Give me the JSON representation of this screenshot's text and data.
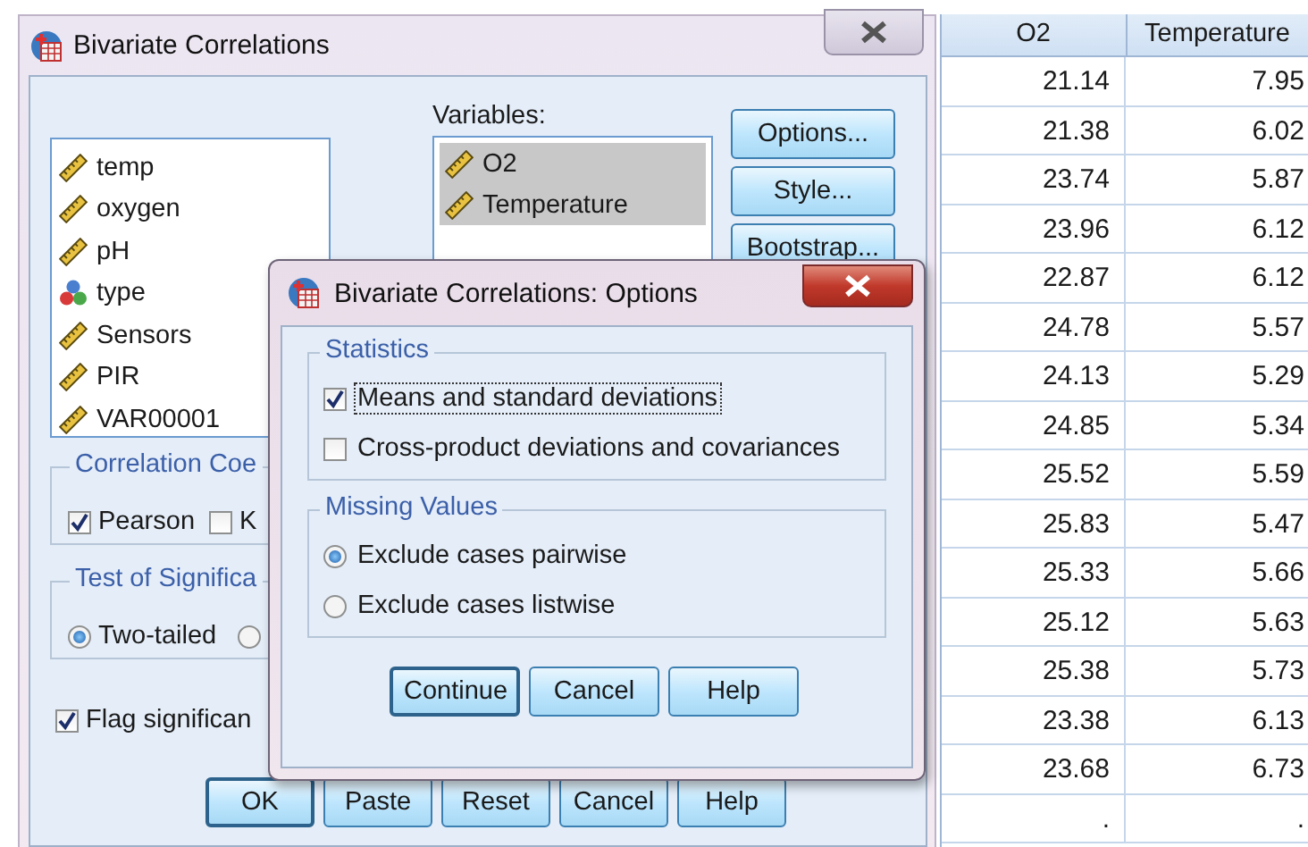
{
  "main_dialog": {
    "title": "Bivariate Correlations",
    "source_variables": [
      {
        "name": "temp",
        "kind": "scale"
      },
      {
        "name": "oxygen",
        "kind": "scale"
      },
      {
        "name": "pH",
        "kind": "scale"
      },
      {
        "name": "type",
        "kind": "nominal"
      },
      {
        "name": "Sensors",
        "kind": "scale"
      },
      {
        "name": "PIR",
        "kind": "scale"
      },
      {
        "name": "VAR00001",
        "kind": "scale"
      }
    ],
    "variables_label": "Variables:",
    "selected_variables": [
      {
        "name": "O2",
        "kind": "scale",
        "selected": true
      },
      {
        "name": "Temperature",
        "kind": "scale",
        "selected": true
      }
    ],
    "side_buttons": [
      "Options...",
      "Style...",
      "Bootstrap..."
    ],
    "correlation_group": {
      "title": "Correlation Coe",
      "options": [
        {
          "label": "Pearson",
          "checked": true
        },
        {
          "label": "K",
          "checked": false
        }
      ]
    },
    "significance_group": {
      "title": "Test of Significa",
      "options": [
        {
          "label": "Two-tailed",
          "selected": true
        },
        {
          "selected": false
        }
      ]
    },
    "flag": {
      "label": "Flag significan",
      "checked": true
    },
    "buttons": [
      {
        "label": "OK",
        "default": true
      },
      {
        "label": "Paste",
        "default": false
      },
      {
        "label": "Reset",
        "default": false
      },
      {
        "label": "Cancel",
        "default": false
      },
      {
        "label": "Help",
        "default": false
      }
    ]
  },
  "options_dialog": {
    "title": "Bivariate Correlations: Options",
    "statistics": {
      "title": "Statistics",
      "options": [
        {
          "label": "Means and standard deviations",
          "checked": true,
          "focused": true
        },
        {
          "label": "Cross-product deviations and covariances",
          "checked": false,
          "focused": false
        }
      ]
    },
    "missing_values": {
      "title": "Missing Values",
      "options": [
        {
          "label": "Exclude cases pairwise",
          "selected": true
        },
        {
          "label": "Exclude cases listwise",
          "selected": false
        }
      ]
    },
    "buttons": [
      {
        "label": "Continue",
        "default": true
      },
      {
        "label": "Cancel",
        "default": false
      },
      {
        "label": "Help",
        "default": false
      }
    ]
  },
  "data_grid": {
    "columns": [
      "O2",
      "Temperature"
    ],
    "rows": [
      [
        "21.14",
        "7.95"
      ],
      [
        "21.38",
        "6.02"
      ],
      [
        "23.74",
        "5.87"
      ],
      [
        "23.96",
        "6.12"
      ],
      [
        "22.87",
        "6.12"
      ],
      [
        "24.78",
        "5.57"
      ],
      [
        "24.13",
        "5.29"
      ],
      [
        "24.85",
        "5.34"
      ],
      [
        "25.52",
        "5.59"
      ],
      [
        "25.83",
        "5.47"
      ],
      [
        "25.33",
        "5.66"
      ],
      [
        "25.12",
        "5.63"
      ],
      [
        "25.38",
        "5.73"
      ],
      [
        "23.38",
        "6.13"
      ],
      [
        "23.68",
        "6.73"
      ],
      [
        ".",
        "."
      ]
    ]
  }
}
